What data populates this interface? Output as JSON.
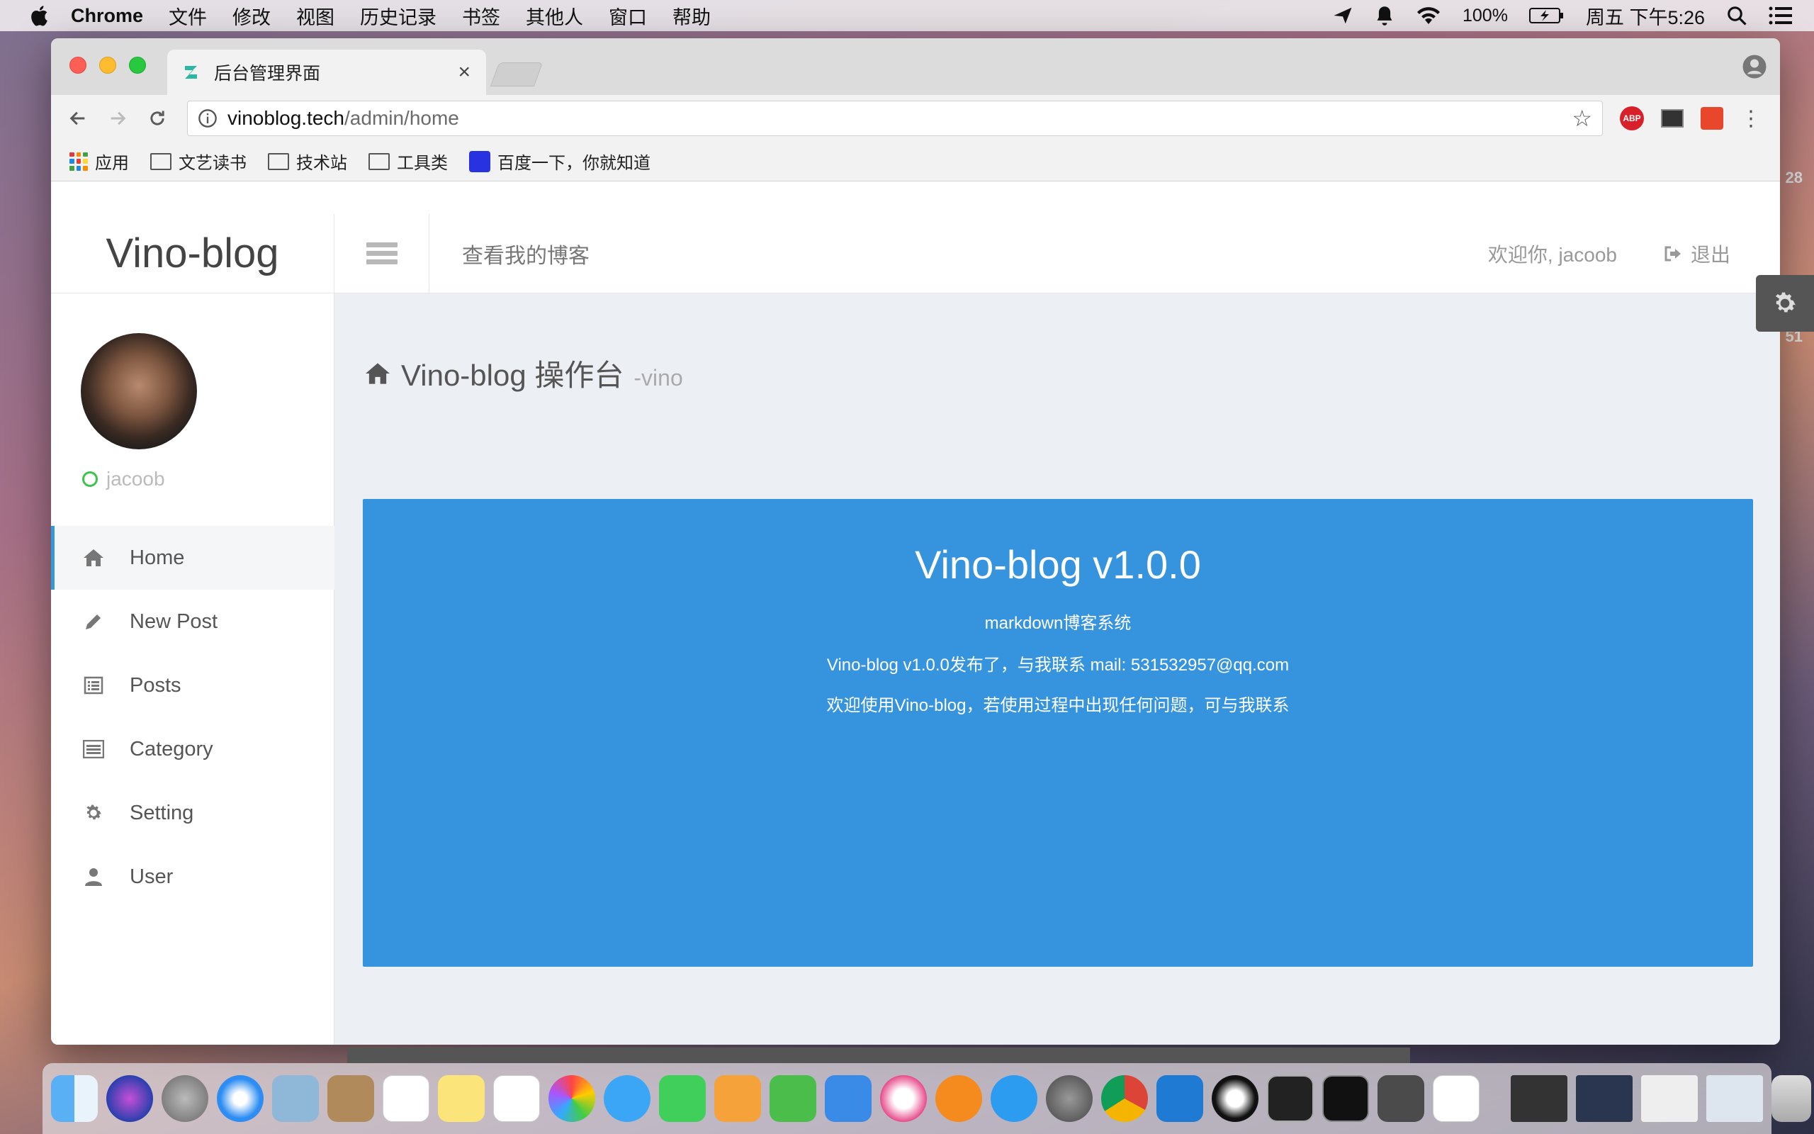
{
  "menubar": {
    "app_name": "Chrome",
    "menus": [
      "文件",
      "修改",
      "视图",
      "历史记录",
      "书签",
      "其他人",
      "窗口",
      "帮助"
    ],
    "battery": "100%",
    "clock": "周五 下午5:26"
  },
  "browser": {
    "tab_title": "后台管理界面",
    "tab_close": "×",
    "url_host": "vinoblog.tech",
    "url_path": "/admin/home",
    "bookmarks": [
      "应用",
      "文艺读书",
      "技术站",
      "工具类",
      "百度一下，你就知道"
    ],
    "ext_abp": "ABP"
  },
  "header": {
    "brand": "Vino-blog",
    "view_blog": "查看我的博客",
    "welcome": "欢迎你, jacoob",
    "logout": "退出"
  },
  "sidebar": {
    "username": "jacoob",
    "items": [
      {
        "label": "Home",
        "icon": "home-icon"
      },
      {
        "label": "New Post",
        "icon": "pencil-icon"
      },
      {
        "label": "Posts",
        "icon": "list-alt-icon"
      },
      {
        "label": "Category",
        "icon": "list-icon"
      },
      {
        "label": "Setting",
        "icon": "gear-icon"
      },
      {
        "label": "User",
        "icon": "user-icon"
      }
    ]
  },
  "main": {
    "title": "Vino-blog 操作台",
    "subtitle": "-vino",
    "banner": {
      "heading": "Vino-blog v1.0.0",
      "tagline": "markdown博客系统",
      "line1": "Vino-blog v1.0.0发布了，与我联系 mail: 531532957@qq.com",
      "line2": "欢迎使用Vino-blog，若使用过程中出现任何问题，可与我联系"
    }
  },
  "background_peek": {
    "num1": "28",
    "num2": "51"
  },
  "colors": {
    "accent": "#3594dd",
    "active_border": "#3498db",
    "status_online": "#3ec44d"
  }
}
